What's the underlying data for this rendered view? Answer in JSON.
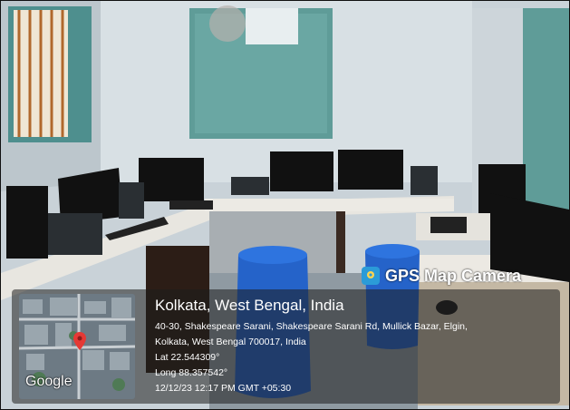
{
  "badge": {
    "icon": "camera-map-pin-icon",
    "label": "GPS Map Camera"
  },
  "location": {
    "title": "Kolkata, West Bengal, India",
    "address_line1": "40-30, Shakespeare Sarani, Shakespeare Sarani Rd, Mullick Bazar, Elgin,",
    "address_line2": "Kolkata, West Bengal 700017, India",
    "lat": "Lat 22.544309°",
    "long": "Long 88.357542°",
    "datetime": "12/12/23 12:17 PM GMT +05:30"
  },
  "map": {
    "watermark": "Google",
    "pin_icon": "map-pin-icon"
  },
  "colors": {
    "overlay": "#1e1e1e",
    "badge_icon": "#2b9bd8",
    "pin": "#e53935"
  }
}
